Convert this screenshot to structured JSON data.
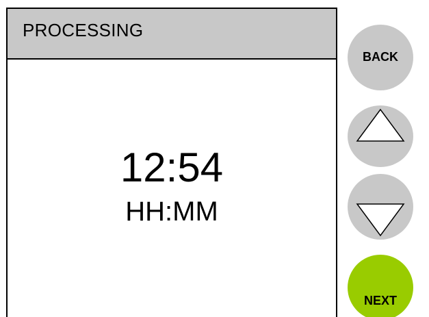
{
  "screen": {
    "title": "PROCESSING",
    "time_value": "12:54",
    "time_unit": "HH:MM"
  },
  "buttons": {
    "back_label": "BACK",
    "up_icon": "triangle-up-icon",
    "down_icon": "triangle-down-icon",
    "next_label": "NEXT"
  },
  "colors": {
    "header_bg": "#c8c8c8",
    "button_gray": "#c8c8c8",
    "next_green": "#99cc00",
    "border": "#000000"
  }
}
